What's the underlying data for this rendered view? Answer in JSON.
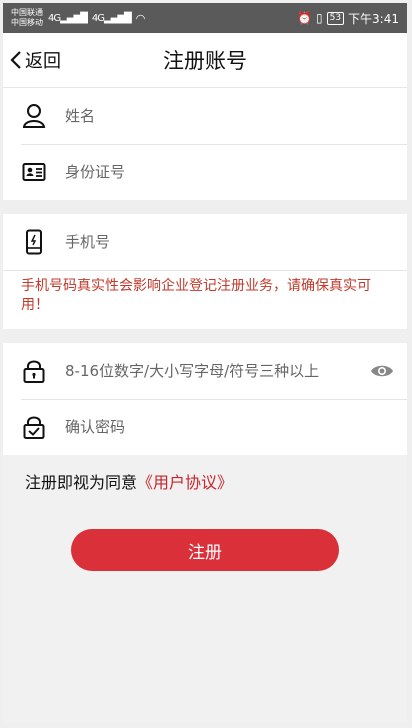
{
  "status_bar": {
    "carrier1": "中国联通",
    "carrier2": "中国移动",
    "signal1": "4G▂▄▆█",
    "signal2": "4G▂▄▆█",
    "wifi": "◠",
    "battery": "53",
    "time": "下午3:41"
  },
  "nav": {
    "back_label": "返回",
    "title": "注册账号"
  },
  "form": {
    "name_placeholder": "姓名",
    "id_placeholder": "身份证号",
    "phone_placeholder": "手机号",
    "phone_warning": "手机号码真实性会影响企业登记注册业务，请确保真实可用！",
    "password_placeholder": "8-16位数字/大小写字母/符号三种以上",
    "confirm_placeholder": "确认密码"
  },
  "agreement": {
    "prefix": "注册即视为同意",
    "link": "《用户协议》"
  },
  "submit_label": "注册",
  "colors": {
    "accent": "#d9303a",
    "warning": "#c0392b"
  }
}
